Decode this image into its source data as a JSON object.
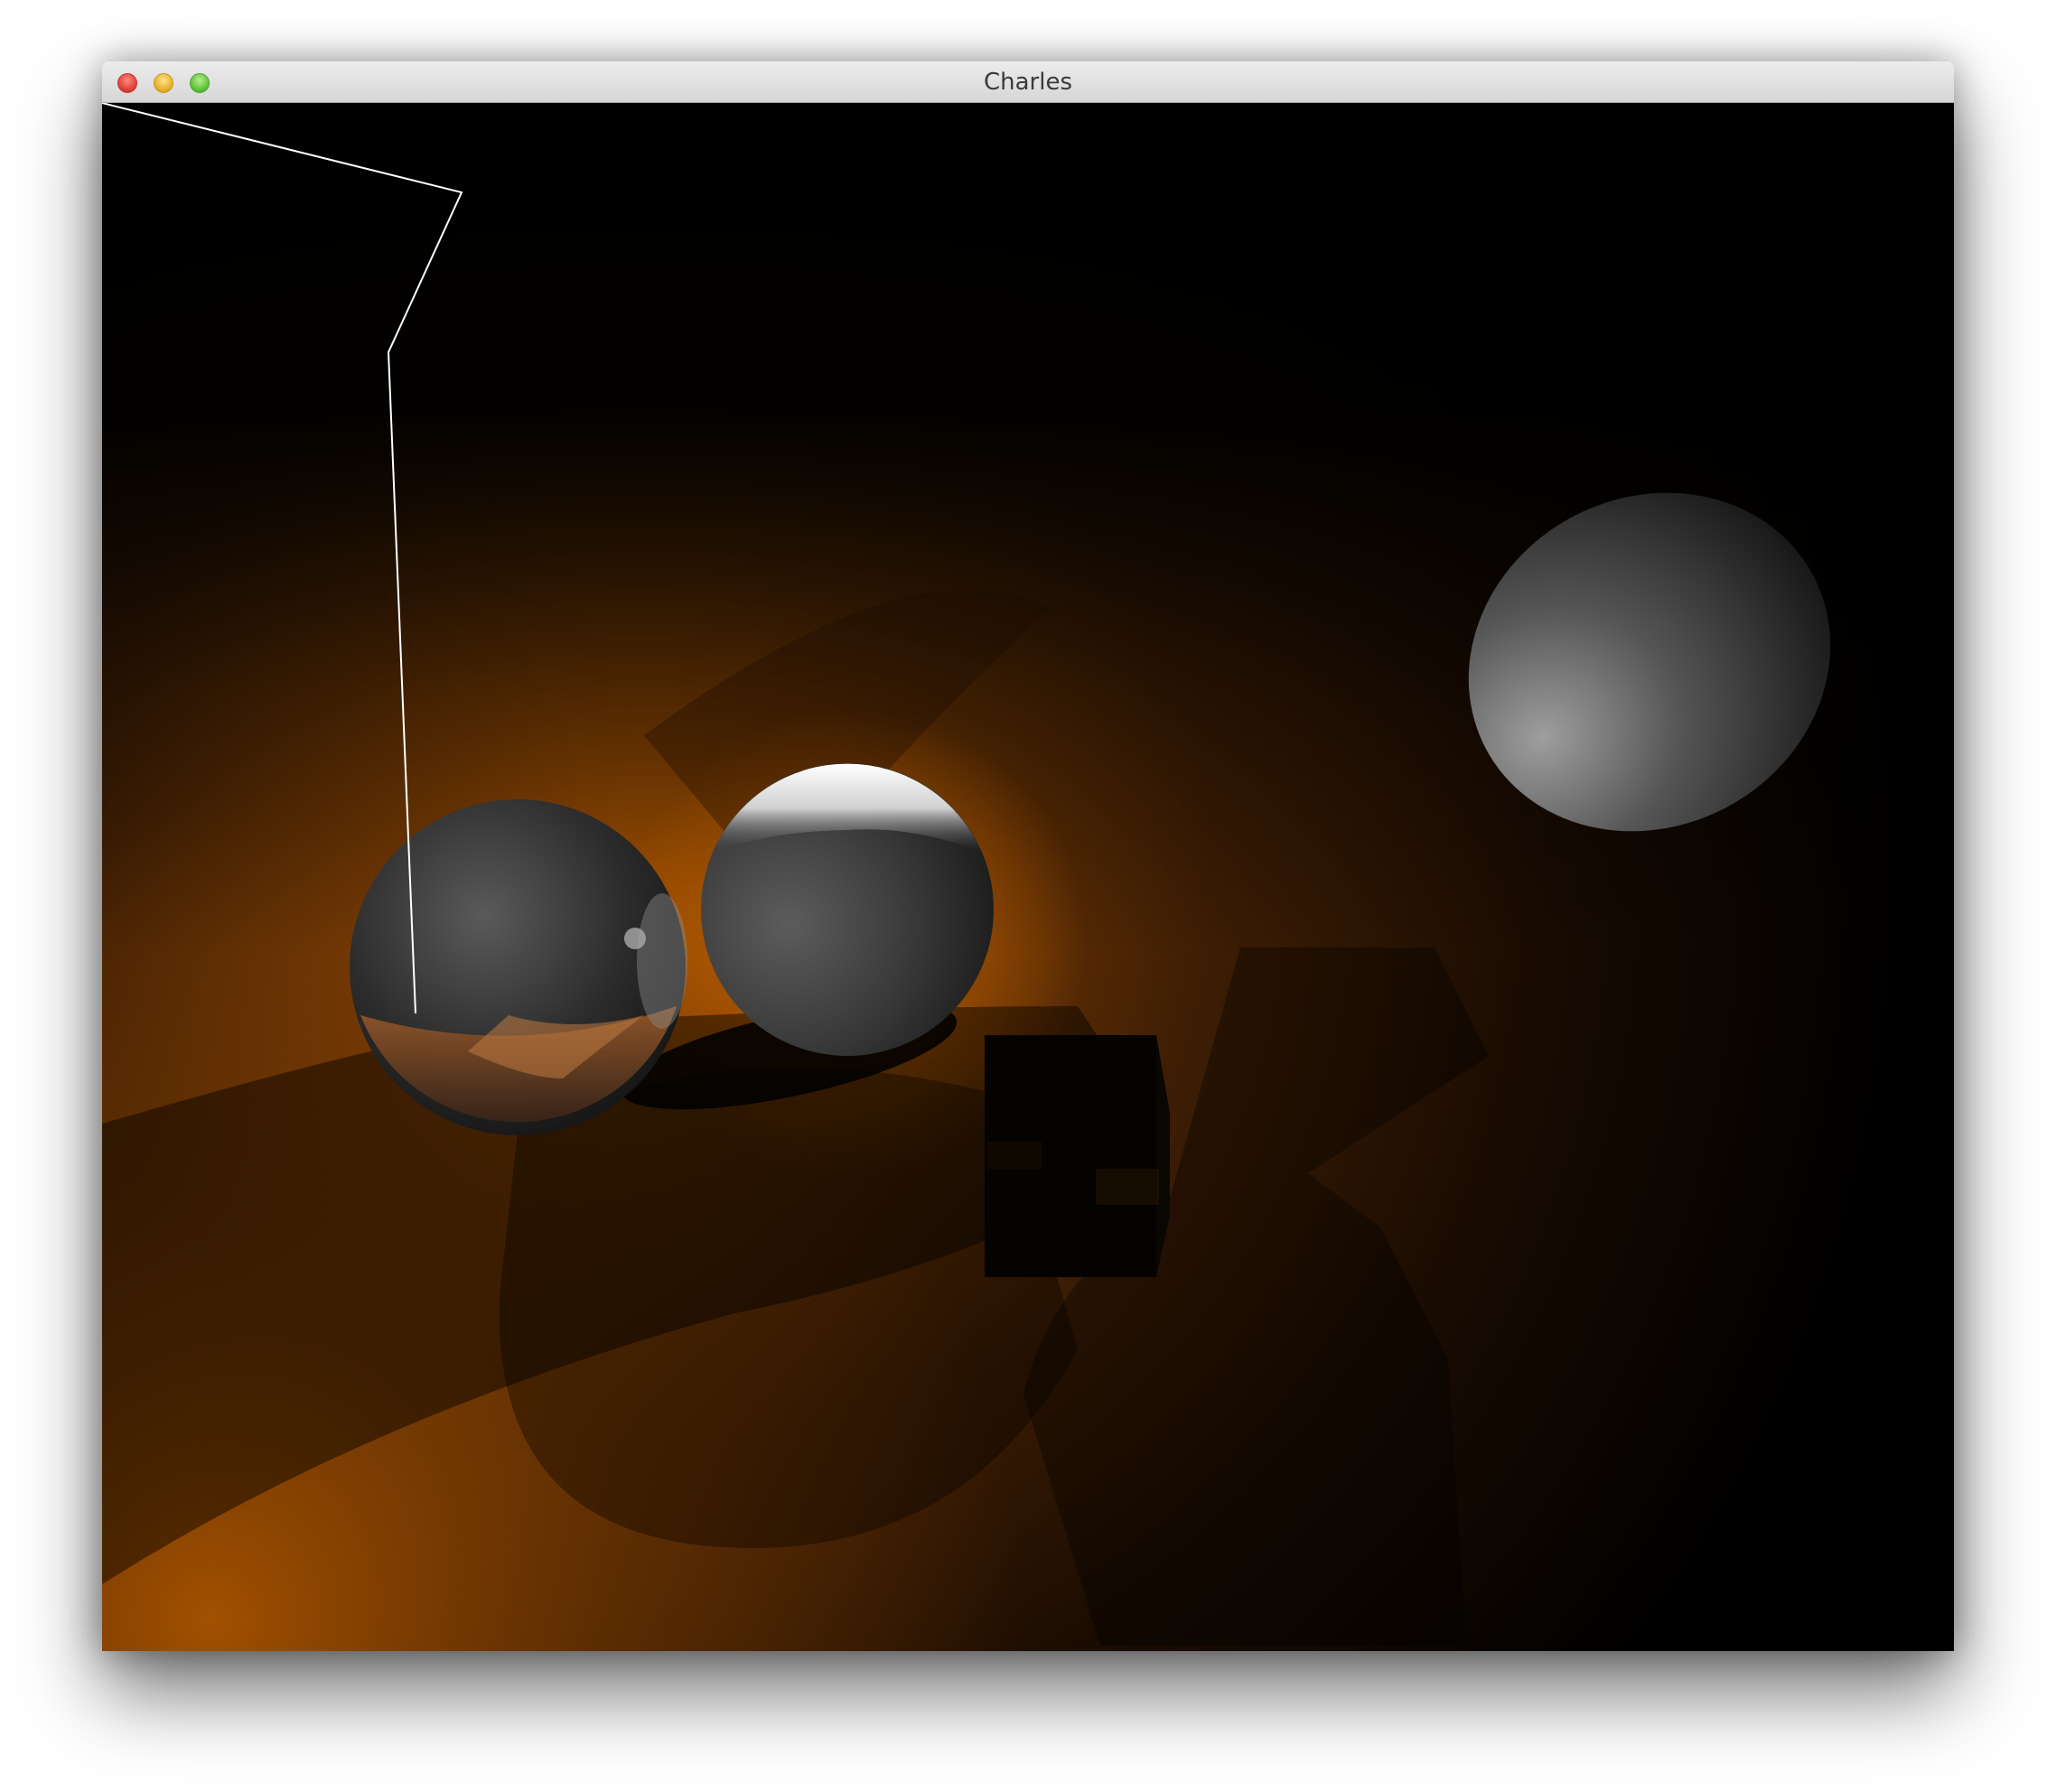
{
  "window": {
    "title": "Charles"
  },
  "scene": {
    "background_color": "#000000",
    "floor_color": "#a04f02",
    "line_color": "#ffffff"
  }
}
